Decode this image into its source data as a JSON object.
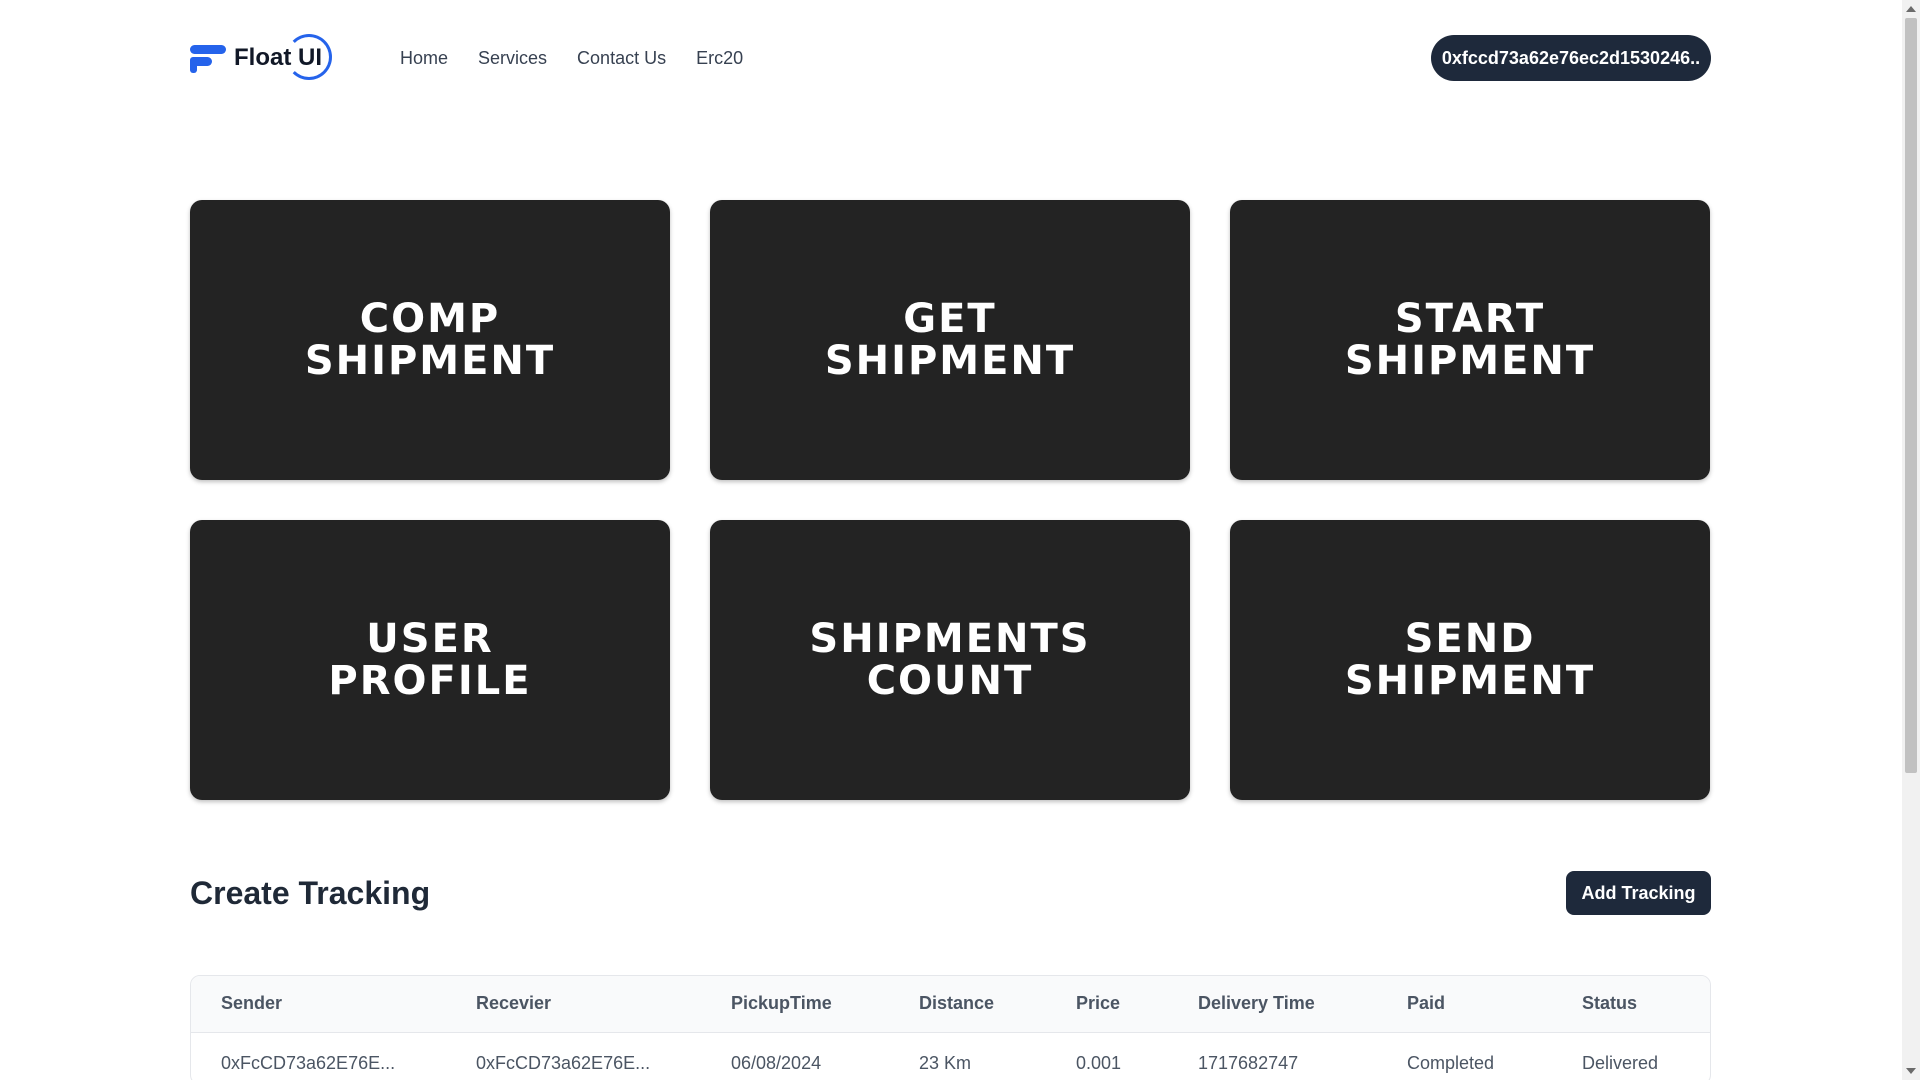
{
  "brand": {
    "name": "Float UI"
  },
  "nav": {
    "items": [
      "Home",
      "Services",
      "Contact Us",
      "Erc20"
    ]
  },
  "wallet": {
    "address": "0xfccd73a62e76ec2d1530246.."
  },
  "cards": [
    {
      "label": "COMP\nSHIPMENT"
    },
    {
      "label": "GET\nSHIPMENT"
    },
    {
      "label": "START\nSHIPMENT"
    },
    {
      "label": "USER\nPROFILE"
    },
    {
      "label": "SHIPMENTS\nCOUNT"
    },
    {
      "label": "SEND\nSHIPMENT"
    }
  ],
  "tracking": {
    "title": "Create Tracking",
    "add_label": "Add Tracking",
    "columns": [
      "Sender",
      "Recevier",
      "PickupTime",
      "Distance",
      "Price",
      "Delivery Time",
      "Paid",
      "Status"
    ],
    "rows": [
      [
        "0xFcCD73a62E76E...",
        "0xFcCD73a62E76E...",
        "06/08/2024",
        "23 Km",
        "0.001",
        "1717682747",
        "Completed",
        "Delivered"
      ]
    ]
  },
  "icons": {
    "logo": "float-ui-logo-icon",
    "scroll_up": "arrow-up-icon",
    "scroll_down": "arrow-down-icon"
  }
}
